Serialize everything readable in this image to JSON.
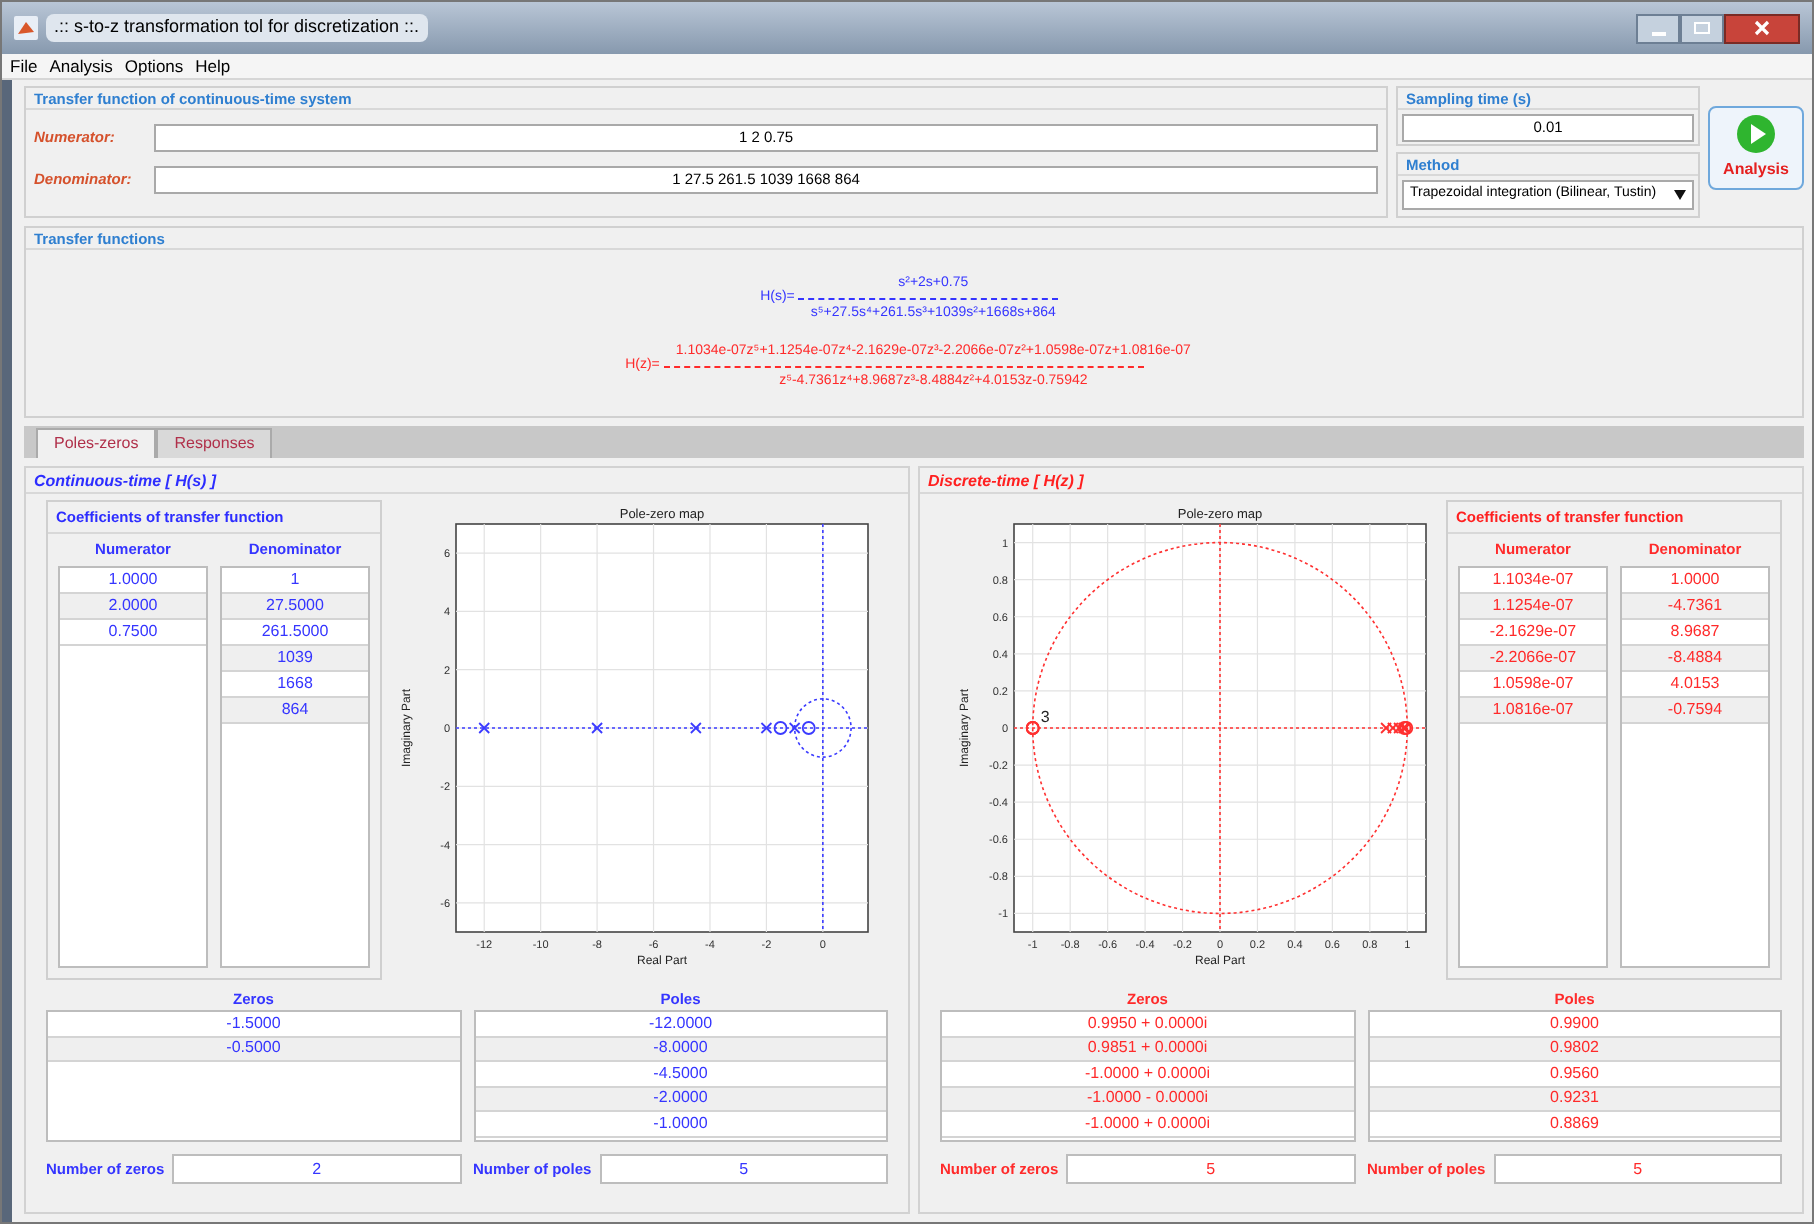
{
  "window": {
    "title": ".:: s-to-z transformation tol for discretization ::."
  },
  "menu": [
    "File",
    "Analysis",
    "Options",
    "Help"
  ],
  "system": {
    "title": "Transfer function of continuous-time system",
    "numerator_label": "Numerator:",
    "numerator": "1 2 0.75",
    "denominator_label": "Denominator:",
    "denominator": "1 27.5 261.5 1039 1668 864"
  },
  "sampling": {
    "title": "Sampling time (s)",
    "value": "0.01"
  },
  "method": {
    "title": "Method",
    "value": "Trapezoidal integration (Bilinear, Tustin)"
  },
  "analysis_button": "Analysis",
  "transfer_functions": {
    "title": "Transfer functions",
    "items": [
      {
        "kind": "continuous",
        "label": "H(s)=",
        "numerator": "s²+2s+0.75",
        "denominator": "s⁵+27.5s⁴+261.5s³+1039s²+1668s+864"
      },
      {
        "kind": "discrete",
        "label": "H(z)=",
        "numerator": "1.1034e-07z⁵+1.1254e-07z⁴-2.1629e-07z³-2.2066e-07z²+1.0598e-07z+1.0816e-07",
        "denominator": "z⁵-4.7361z⁴+8.9687z³-8.4884z²+4.0153z-0.75942"
      }
    ]
  },
  "tabs": [
    {
      "label": "Poles-zeros",
      "selected": true
    },
    {
      "label": "Responses",
      "selected": false
    }
  ],
  "sections": [
    {
      "kind": "continuous",
      "title": "Continuous-time [ H(s) ]",
      "coefficients": {
        "title": "Coefficients of transfer function",
        "numerator_header": "Numerator",
        "denominator_header": "Denominator",
        "numerator": [
          "1.0000",
          "2.0000",
          "0.7500"
        ],
        "denominator": [
          "1",
          "27.5000",
          "261.5000",
          "1039",
          "1668",
          "864"
        ]
      },
      "chart_data": {
        "type": "scatter",
        "title": "Pole-zero map",
        "xlabel": "Real Part",
        "ylabel": "Imaginary Part",
        "xlim": [
          -13,
          1.6
        ],
        "ylim": [
          -7,
          7
        ],
        "xticks": [
          -12,
          -10,
          -8,
          -6,
          -4,
          -2,
          0
        ],
        "yticks": [
          -6,
          -4,
          -2,
          0,
          2,
          4,
          6
        ],
        "series": [
          {
            "marker": "x",
            "color": "#3b3bff",
            "x": [
              -12,
              -8,
              -4.5,
              -2,
              -1
            ],
            "values": [
              0,
              0,
              0,
              0,
              0
            ]
          },
          {
            "marker": "o",
            "color": "#3b3bff",
            "x": [
              -1.5,
              -0.5
            ],
            "values": [
              0,
              0
            ]
          }
        ],
        "grid": true
      },
      "zeros": {
        "header": "Zeros",
        "values": [
          "-1.5000",
          "-0.5000"
        ]
      },
      "poles": {
        "header": "Poles",
        "values": [
          "-12.0000",
          "-8.0000",
          "-4.5000",
          "-2.0000",
          "-1.0000"
        ]
      },
      "zeros_count": {
        "label": "Number of zeros",
        "value": "2"
      },
      "poles_count": {
        "label": "Number of poles",
        "value": "5"
      }
    },
    {
      "kind": "discrete",
      "title": "Discrete-time [ H(z) ]",
      "coefficients": {
        "title": "Coefficients of transfer function",
        "numerator_header": "Numerator",
        "denominator_header": "Denominator",
        "numerator": [
          "1.1034e-07",
          "1.1254e-07",
          "-2.1629e-07",
          "-2.2066e-07",
          "1.0598e-07",
          "1.0816e-07"
        ],
        "denominator": [
          "1.0000",
          "-4.7361",
          "8.9687",
          "-8.4884",
          "4.0153",
          "-0.7594"
        ]
      },
      "chart_data": {
        "type": "scatter",
        "title": "Pole-zero map",
        "xlabel": "Real Part",
        "ylabel": "Imaginary Part",
        "xlim": [
          -1.1,
          1.1
        ],
        "ylim": [
          -1.1,
          1.1
        ],
        "xticks": [
          -1,
          -0.8,
          -0.6,
          -0.4,
          -0.2,
          0,
          0.2,
          0.4,
          0.6,
          0.8,
          1
        ],
        "yticks": [
          -1,
          -0.8,
          -0.6,
          -0.4,
          -0.2,
          0,
          0.2,
          0.4,
          0.6,
          0.8,
          1
        ],
        "series": [
          {
            "marker": "x",
            "color": "#ff3030",
            "x": [
              0.99,
              0.9802,
              0.956,
              0.9231,
              0.8869
            ],
            "values": [
              0,
              0,
              0,
              0,
              0
            ]
          },
          {
            "marker": "o",
            "color": "#ff3030",
            "x": [
              0.995,
              0.9851,
              -1,
              -1,
              -1
            ],
            "values": [
              0,
              0,
              0,
              0,
              0
            ]
          }
        ],
        "grid": true,
        "annotations": [
          {
            "x": -1,
            "y": 0,
            "text": "3"
          }
        ]
      },
      "zeros": {
        "header": "Zeros",
        "values": [
          "0.9950 + 0.0000i",
          "0.9851 + 0.0000i",
          "-1.0000 + 0.0000i",
          "-1.0000 - 0.0000i",
          "-1.0000 + 0.0000i"
        ]
      },
      "poles": {
        "header": "Poles",
        "values": [
          "0.9900",
          "0.9802",
          "0.9560",
          "0.9231",
          "0.8869"
        ]
      },
      "zeros_count": {
        "label": "Number of zeros",
        "value": "5"
      },
      "poles_count": {
        "label": "Number of poles",
        "value": "5"
      }
    }
  ]
}
